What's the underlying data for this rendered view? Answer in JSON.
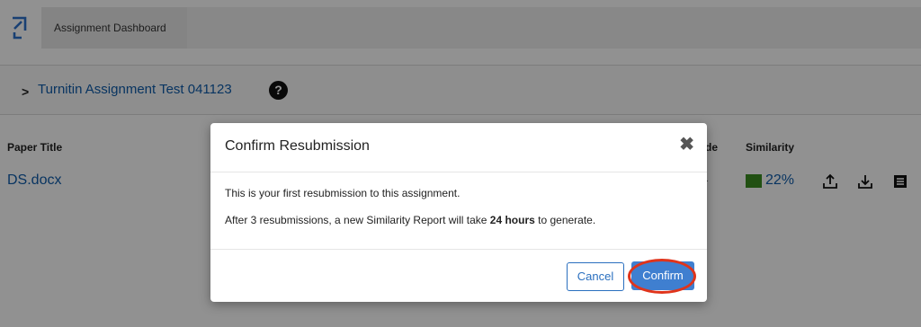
{
  "header": {
    "tab_label": "Assignment Dashboard"
  },
  "assignment": {
    "title": "Turnitin Assignment Test 041123",
    "help_glyph": "?"
  },
  "table": {
    "columns": {
      "paper_title": "Paper Title",
      "grade_partial": "de",
      "similarity": "Similarity"
    },
    "row": {
      "paper_title": "DS.docx",
      "grade_value": "-",
      "similarity": "22%",
      "similarity_color": "#3a8a1f"
    }
  },
  "modal": {
    "title": "Confirm Resubmission",
    "close_glyph": "✖",
    "line1": "This is your first resubmission to this assignment.",
    "line2_prefix": "After 3 resubmissions, a new Similarity Report will take ",
    "line2_bold": "24 hours",
    "line2_suffix": " to generate.",
    "cancel_label": "Cancel",
    "confirm_label": "Confirm"
  },
  "colors": {
    "link": "#0e5aa7",
    "primary": "#3f7fd0",
    "highlight_ring": "#e0341b"
  }
}
